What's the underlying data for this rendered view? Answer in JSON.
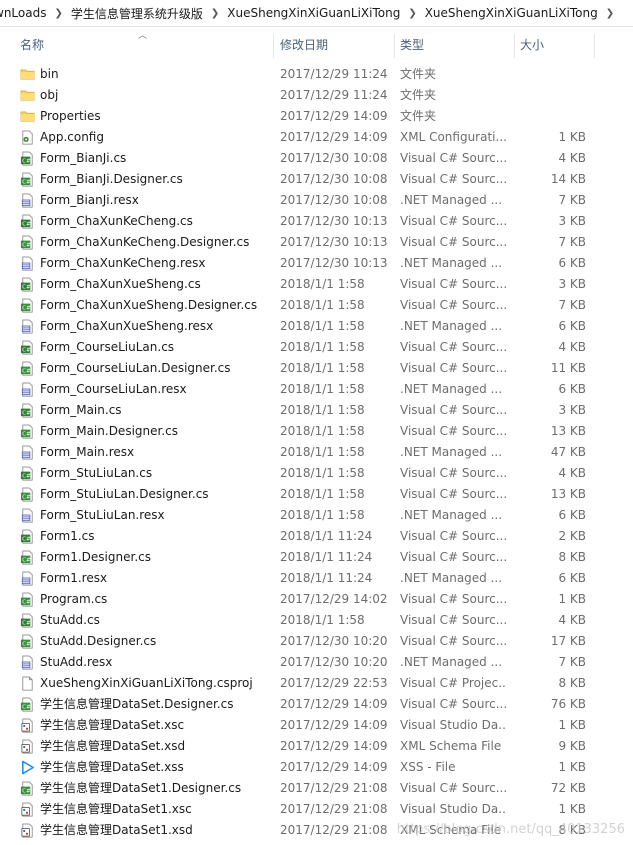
{
  "breadcrumb": [
    "wnLoads",
    "学生信息管理系统升级版",
    "XueShengXinXiGuanLiXiTong",
    "XueShengXinXiGuanLiXiTong"
  ],
  "columns": {
    "name": "名称",
    "date": "修改日期",
    "type": "类型",
    "size": "大小"
  },
  "files": [
    {
      "name": "bin",
      "date": "2017/12/29 11:24",
      "type": "文件夹",
      "size": "",
      "icon": "folder-icon"
    },
    {
      "name": "obj",
      "date": "2017/12/29 11:24",
      "type": "文件夹",
      "size": "",
      "icon": "folder-icon"
    },
    {
      "name": "Properties",
      "date": "2017/12/29 14:09",
      "type": "文件夹",
      "size": "",
      "icon": "folder-icon"
    },
    {
      "name": "App.config",
      "date": "2017/12/29 14:09",
      "type": "XML Configurati...",
      "size": "1 KB",
      "icon": "config-file-icon"
    },
    {
      "name": "Form_BianJi.cs",
      "date": "2017/12/30 10:08",
      "type": "Visual C# Sourc...",
      "size": "4 KB",
      "icon": "csharp-form-icon"
    },
    {
      "name": "Form_BianJi.Designer.cs",
      "date": "2017/12/30 10:08",
      "type": "Visual C# Sourc...",
      "size": "14 KB",
      "icon": "csharp-file-icon"
    },
    {
      "name": "Form_BianJi.resx",
      "date": "2017/12/30 10:08",
      "type": ".NET Managed ...",
      "size": "7 KB",
      "icon": "resx-file-icon"
    },
    {
      "name": "Form_ChaXunKeCheng.cs",
      "date": "2017/12/30 10:13",
      "type": "Visual C# Sourc...",
      "size": "3 KB",
      "icon": "csharp-form-icon"
    },
    {
      "name": "Form_ChaXunKeCheng.Designer.cs",
      "date": "2017/12/30 10:13",
      "type": "Visual C# Sourc...",
      "size": "7 KB",
      "icon": "csharp-file-icon"
    },
    {
      "name": "Form_ChaXunKeCheng.resx",
      "date": "2017/12/30 10:13",
      "type": ".NET Managed ...",
      "size": "6 KB",
      "icon": "resx-file-icon"
    },
    {
      "name": "Form_ChaXunXueSheng.cs",
      "date": "2018/1/1 1:58",
      "type": "Visual C# Sourc...",
      "size": "3 KB",
      "icon": "csharp-form-icon"
    },
    {
      "name": "Form_ChaXunXueSheng.Designer.cs",
      "date": "2018/1/1 1:58",
      "type": "Visual C# Sourc...",
      "size": "7 KB",
      "icon": "csharp-file-icon"
    },
    {
      "name": "Form_ChaXunXueSheng.resx",
      "date": "2018/1/1 1:58",
      "type": ".NET Managed ...",
      "size": "6 KB",
      "icon": "resx-file-icon"
    },
    {
      "name": "Form_CourseLiuLan.cs",
      "date": "2018/1/1 1:58",
      "type": "Visual C# Sourc...",
      "size": "4 KB",
      "icon": "csharp-form-icon"
    },
    {
      "name": "Form_CourseLiuLan.Designer.cs",
      "date": "2018/1/1 1:58",
      "type": "Visual C# Sourc...",
      "size": "11 KB",
      "icon": "csharp-file-icon"
    },
    {
      "name": "Form_CourseLiuLan.resx",
      "date": "2018/1/1 1:58",
      "type": ".NET Managed ...",
      "size": "6 KB",
      "icon": "resx-file-icon"
    },
    {
      "name": "Form_Main.cs",
      "date": "2018/1/1 1:58",
      "type": "Visual C# Sourc...",
      "size": "3 KB",
      "icon": "csharp-form-icon"
    },
    {
      "name": "Form_Main.Designer.cs",
      "date": "2018/1/1 1:58",
      "type": "Visual C# Sourc...",
      "size": "13 KB",
      "icon": "csharp-file-icon"
    },
    {
      "name": "Form_Main.resx",
      "date": "2018/1/1 1:58",
      "type": ".NET Managed ...",
      "size": "47 KB",
      "icon": "resx-file-icon"
    },
    {
      "name": "Form_StuLiuLan.cs",
      "date": "2018/1/1 1:58",
      "type": "Visual C# Sourc...",
      "size": "4 KB",
      "icon": "csharp-form-icon"
    },
    {
      "name": "Form_StuLiuLan.Designer.cs",
      "date": "2018/1/1 1:58",
      "type": "Visual C# Sourc...",
      "size": "13 KB",
      "icon": "csharp-file-icon"
    },
    {
      "name": "Form_StuLiuLan.resx",
      "date": "2018/1/1 1:58",
      "type": ".NET Managed ...",
      "size": "6 KB",
      "icon": "resx-file-icon"
    },
    {
      "name": "Form1.cs",
      "date": "2018/1/1 11:24",
      "type": "Visual C# Sourc...",
      "size": "2 KB",
      "icon": "csharp-form-icon"
    },
    {
      "name": "Form1.Designer.cs",
      "date": "2018/1/1 11:24",
      "type": "Visual C# Sourc...",
      "size": "8 KB",
      "icon": "csharp-file-icon"
    },
    {
      "name": "Form1.resx",
      "date": "2018/1/1 11:24",
      "type": ".NET Managed ...",
      "size": "6 KB",
      "icon": "resx-file-icon"
    },
    {
      "name": "Program.cs",
      "date": "2017/12/29 14:02",
      "type": "Visual C# Sourc...",
      "size": "1 KB",
      "icon": "csharp-file-icon"
    },
    {
      "name": "StuAdd.cs",
      "date": "2018/1/1 1:58",
      "type": "Visual C# Sourc...",
      "size": "4 KB",
      "icon": "csharp-form-icon"
    },
    {
      "name": "StuAdd.Designer.cs",
      "date": "2017/12/30 10:20",
      "type": "Visual C# Sourc...",
      "size": "17 KB",
      "icon": "csharp-file-icon"
    },
    {
      "name": "StuAdd.resx",
      "date": "2017/12/30 10:20",
      "type": ".NET Managed ...",
      "size": "7 KB",
      "icon": "resx-file-icon"
    },
    {
      "name": "XueShengXinXiGuanLiXiTong.csproj",
      "date": "2017/12/29 22:53",
      "type": "Visual C# Projec...",
      "size": "8 KB",
      "icon": "blank-file-icon"
    },
    {
      "name": "学生信息管理DataSet.Designer.cs",
      "date": "2017/12/29 14:09",
      "type": "Visual C# Sourc...",
      "size": "76 KB",
      "icon": "csharp-file-icon"
    },
    {
      "name": "学生信息管理DataSet.xsc",
      "date": "2017/12/29 14:09",
      "type": "Visual Studio Da...",
      "size": "1 KB",
      "icon": "vs-data-icon"
    },
    {
      "name": "学生信息管理DataSet.xsd",
      "date": "2017/12/29 14:09",
      "type": "XML Schema File",
      "size": "9 KB",
      "icon": "vs-data-icon"
    },
    {
      "name": "学生信息管理DataSet.xss",
      "date": "2017/12/29 14:09",
      "type": "XSS - File",
      "size": "1 KB",
      "icon": "play-icon"
    },
    {
      "name": "学生信息管理DataSet1.Designer.cs",
      "date": "2017/12/29 21:08",
      "type": "Visual C# Sourc...",
      "size": "72 KB",
      "icon": "csharp-file-icon"
    },
    {
      "name": "学生信息管理DataSet1.xsc",
      "date": "2017/12/29 21:08",
      "type": "Visual Studio Da...",
      "size": "1 KB",
      "icon": "vs-data-icon"
    },
    {
      "name": "学生信息管理DataSet1.xsd",
      "date": "2017/12/29 21:08",
      "type": "XML Schema File",
      "size": "8 KB",
      "icon": "vs-data-icon"
    }
  ],
  "watermark": "https://blog.csdn.net/qq_40133256"
}
